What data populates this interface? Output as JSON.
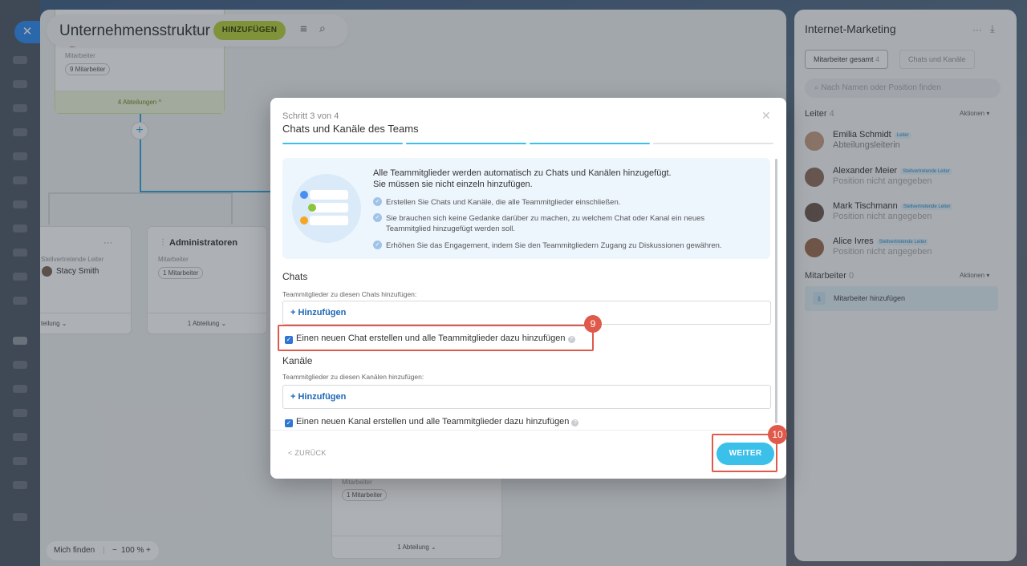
{
  "app": {
    "title": "Unternehmensstruktur",
    "add_button": "HINZUFÜGEN",
    "zoom": {
      "find_me": "Mich finden",
      "minus": "−",
      "value": "100 %",
      "plus": "+"
    }
  },
  "canvas": {
    "top_card": {
      "role": "Abteilungsleiterin",
      "label": "Mitarbeiter",
      "count": "9 Mitarbeiter",
      "footer": "4 Abteilungen ^"
    },
    "left_card": {
      "dots": "···",
      "role": "Stellvertretende Leiter",
      "person": "Stacy Smith",
      "footer": "teilung ⌄"
    },
    "admin_card": {
      "title": "Administratoren",
      "label": "Mitarbeiter",
      "count": "1 Mitarbeiter",
      "footer": "1 Abteilung ⌄"
    },
    "bottom_card": {
      "label": "Mitarbeiter",
      "count": "1 Mitarbeiter",
      "footer": "1 Abteilung ⌄"
    }
  },
  "panel": {
    "title": "Internet-Marketing",
    "tabs": [
      {
        "label": "Mitarbeiter gesamt",
        "count": "4"
      },
      {
        "label": "Chats und Kanäle"
      }
    ],
    "search_placeholder": "Nach Namen oder Position finden",
    "leaders": {
      "label": "Leiter",
      "count": "4",
      "action": "Aktionen"
    },
    "people": [
      {
        "name": "Emilia Schmidt",
        "role": "Leiter",
        "position": "Abteilungsleiterin"
      },
      {
        "name": "Alexander Meier",
        "role": "Stellvertretende Leiter",
        "position": "Position nicht angegeben"
      },
      {
        "name": "Mark Tischmann",
        "role": "Stellvertretende Leiter",
        "position": "Position nicht angegeben"
      },
      {
        "name": "Alice Ivres",
        "role": "Stellvertretende Leiter",
        "position": "Position nicht angegeben"
      }
    ],
    "members": {
      "label": "Mitarbeiter",
      "count": "0",
      "action": "Aktionen"
    },
    "add_member": "Mitarbeiter hinzufügen"
  },
  "modal": {
    "step": "Schritt 3 von 4",
    "title": "Chats und Kanäle des Teams",
    "progress": {
      "done": 3,
      "total": 4
    },
    "info": {
      "heading_line1": "Alle Teammitglieder werden automatisch zu Chats und Kanälen hinzugefügt.",
      "heading_line2": "Sie müssen sie nicht einzeln hinzufügen.",
      "items": [
        "Erstellen Sie Chats und Kanäle, die alle Teammitglieder einschließen.",
        "Sie brauchen sich keine Gedanke darüber zu machen, zu welchem Chat oder Kanal ein neues Teammitglied hinzugefügt werden soll.",
        "Erhöhen Sie das Engagement, indem Sie den Teammitgliedern Zugang zu Diskussionen gewähren."
      ]
    },
    "chats": {
      "heading": "Chats",
      "sub": "Teammitglieder zu diesen Chats hinzufügen:",
      "add": "+ Hinzufügen",
      "checkbox": "Einen neuen Chat erstellen und alle Teammitglieder dazu hinzufügen"
    },
    "channels": {
      "heading": "Kanäle",
      "sub": "Teammitglieder zu diesen Kanälen hinzufügen:",
      "add": "+ Hinzufügen",
      "checkbox": "Einen neuen Kanal erstellen und alle Teammitglieder dazu hinzufügen"
    },
    "back": "< ZURÜCK",
    "next": "WEITER"
  },
  "annotations": {
    "badge_chat": "9",
    "badge_next": "10"
  },
  "colors": {
    "accent": "#3bc0ea",
    "highlight": "#e05a4b",
    "add_button": "#b9d13a",
    "link": "#1f67b5"
  },
  "icons": [
    "close-icon",
    "pin-icon",
    "menu-icon",
    "search-icon",
    "plus-icon",
    "drag-handle-icon",
    "check-circle-icon",
    "checkbox-icon",
    "help-icon",
    "more-icon",
    "collapse-icon",
    "add-user-icon"
  ]
}
